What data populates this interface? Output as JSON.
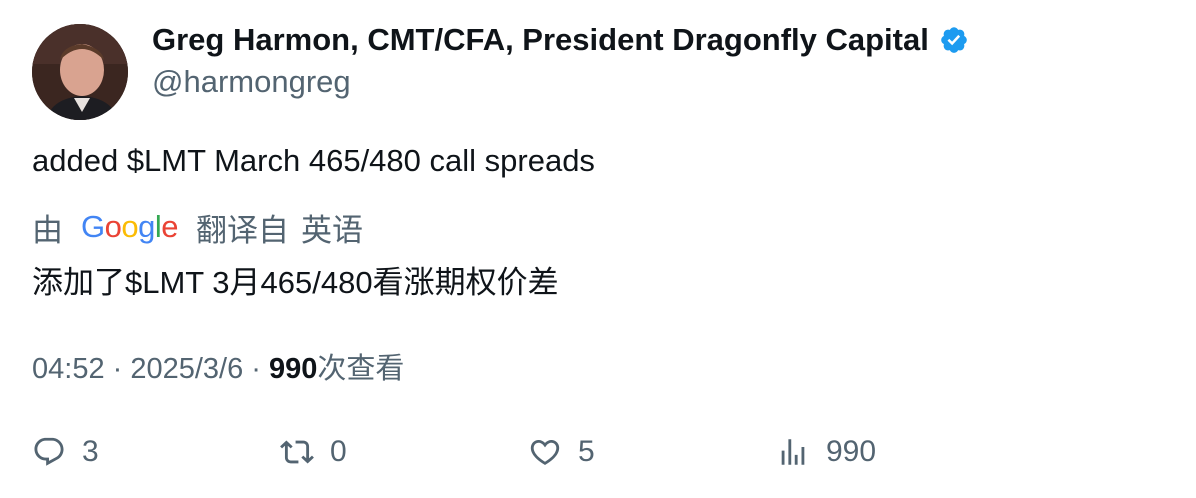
{
  "author": {
    "display_name": "Greg Harmon, CMT/CFA, President Dragonfly Capital",
    "handle": "@harmongreg",
    "verified_icon": "verified-badge-icon",
    "avatar_icon": "avatar-photo"
  },
  "tweet": {
    "text": "added $LMT March 465/480 call spreads"
  },
  "translation": {
    "prefix": "由",
    "google_letters": [
      "G",
      "o",
      "o",
      "g",
      "l",
      "e"
    ],
    "suffix": "翻译自",
    "language": "英语",
    "text": "添加了$LMT 3月465/480看涨期权价差"
  },
  "meta": {
    "time": "04:52",
    "sep1": " · ",
    "date": "2025/3/6",
    "sep2": " · ",
    "views": "990",
    "views_label": "次查看"
  },
  "actions": {
    "reply": {
      "icon": "reply-icon",
      "count": "3"
    },
    "retweet": {
      "icon": "retweet-icon",
      "count": "0"
    },
    "like": {
      "icon": "heart-icon",
      "count": "5"
    },
    "views": {
      "icon": "analytics-icon",
      "count": "990"
    }
  },
  "colors": {
    "verified": "#1d9bf0",
    "secondary_text": "#536471",
    "primary_text": "#0f1419"
  }
}
